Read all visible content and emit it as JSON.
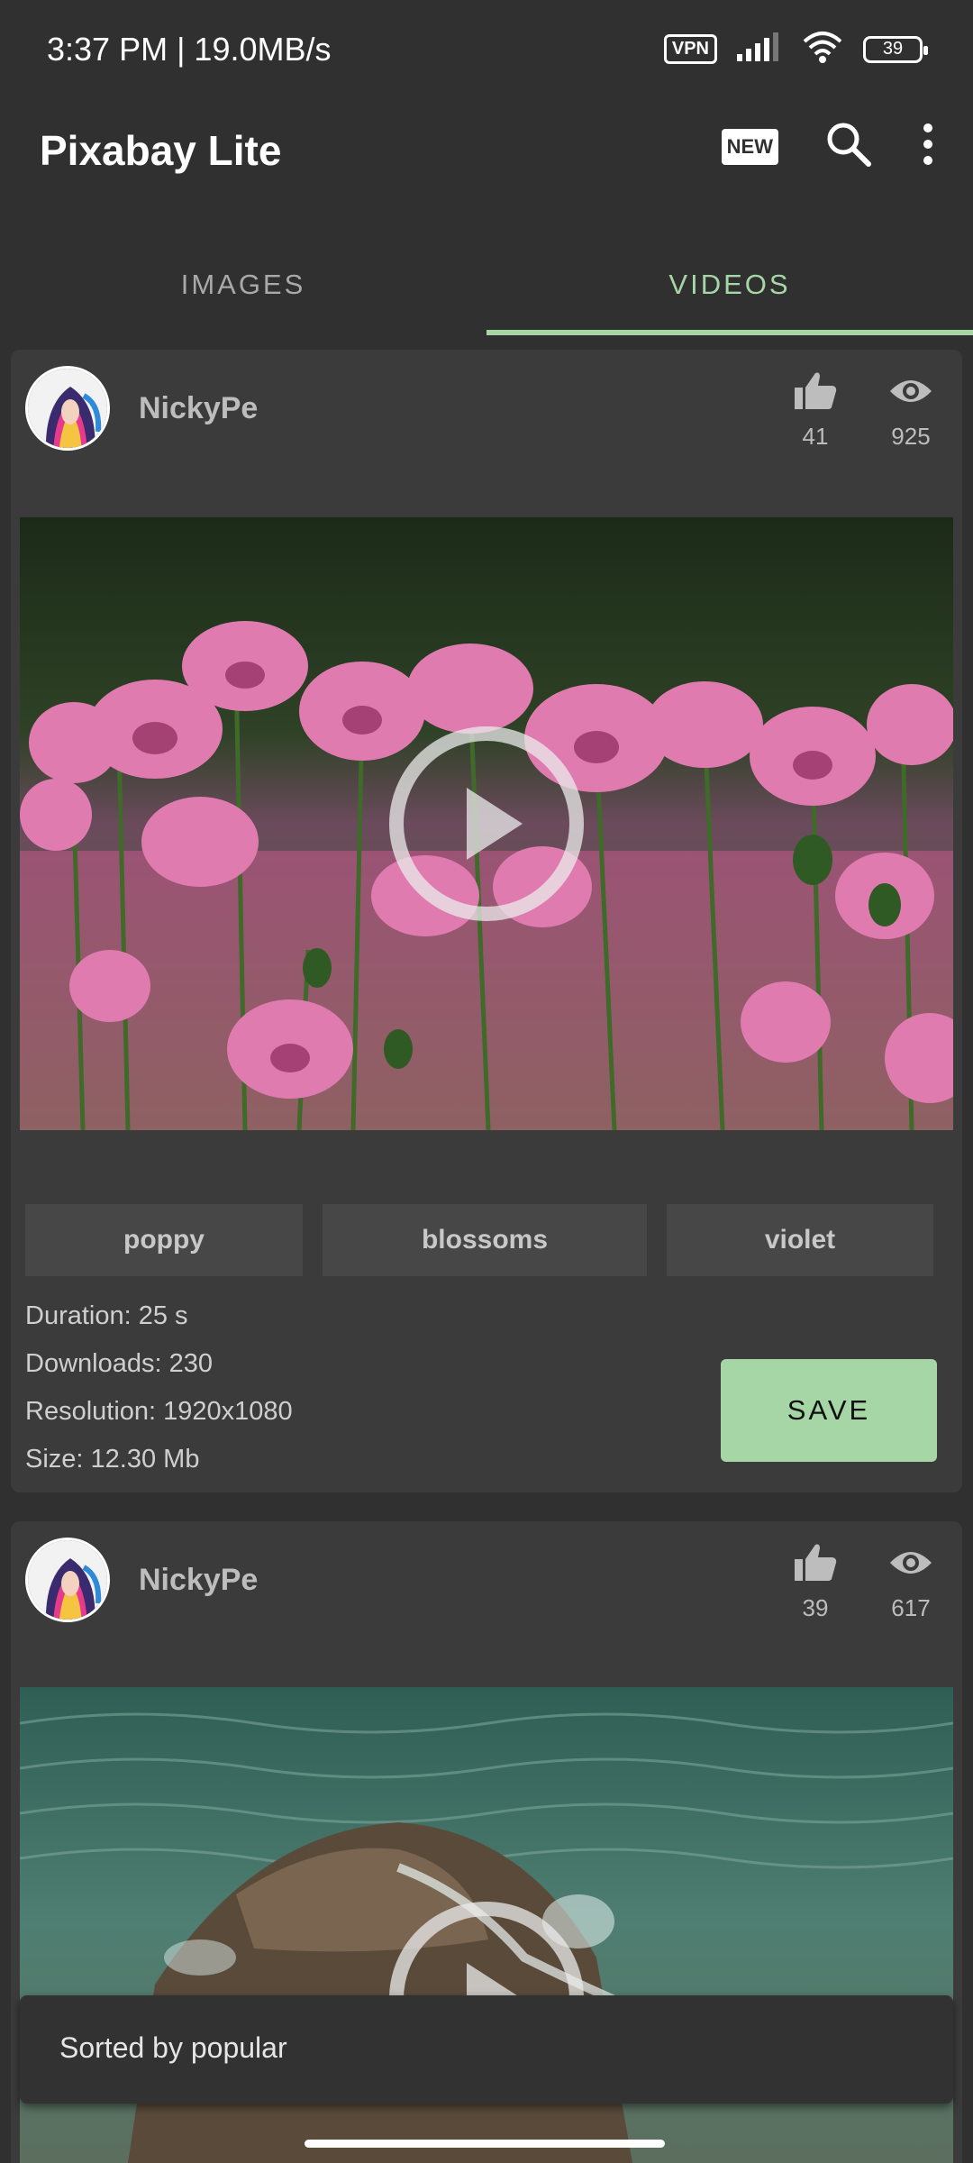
{
  "status_bar": {
    "time": "3:37 PM | 19.0MB/s",
    "vpn_label": "VPN",
    "battery": "39"
  },
  "app_bar": {
    "title": "Pixabay Lite",
    "new_badge": "NEW",
    "icons": [
      "new-icon",
      "search-icon",
      "more-vert-icon"
    ]
  },
  "tabs": [
    {
      "label": "IMAGES",
      "active": false
    },
    {
      "label": "VIDEOS",
      "active": true
    }
  ],
  "cards": [
    {
      "author": "NickyPe",
      "likes": "41",
      "views": "925",
      "tags": [
        "poppy",
        "blossoms",
        "violet"
      ],
      "duration": "Duration: 25 s",
      "downloads": "Downloads: 230",
      "resolution": "Resolution: 1920x1080",
      "size": "Size: 12.30 Mb",
      "save_label": "SAVE"
    },
    {
      "author": "NickyPe",
      "likes": "39",
      "views": "617"
    }
  ],
  "snackbar": {
    "message": "Sorted by popular"
  },
  "colors": {
    "accent": "#a6d5a6",
    "background": "#303030",
    "card": "#3b3b3b"
  }
}
